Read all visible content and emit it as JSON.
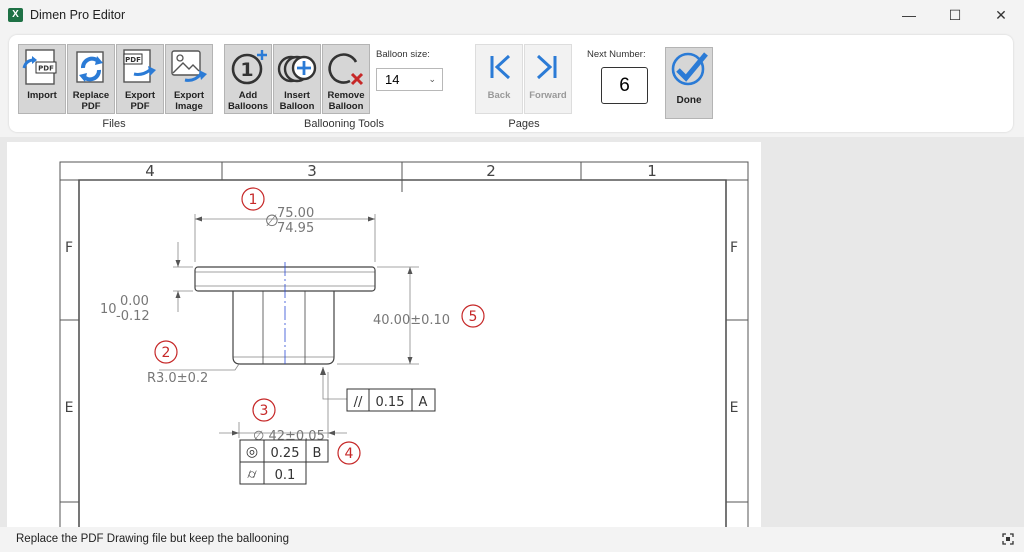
{
  "window": {
    "title": "Dimen Pro Editor",
    "app_icon_letter": "X",
    "controls": {
      "minimize": "—",
      "maximize": "☐",
      "close": "✕"
    }
  },
  "ribbon": {
    "files": {
      "label": "Files",
      "buttons": [
        {
          "label": "Import",
          "icon": "import-pdf-icon"
        },
        {
          "label": "Replace\nPDF",
          "icon": "replace-pdf-icon"
        },
        {
          "label": "Export\nPDF",
          "icon": "export-pdf-icon"
        },
        {
          "label": "Export\nImage",
          "icon": "export-image-icon"
        }
      ],
      "pdf_badge": "PDF"
    },
    "ballooning": {
      "label": "Ballooning Tools",
      "buttons": [
        {
          "label": "Add\nBalloons",
          "icon": "add-balloon-icon"
        },
        {
          "label": "Insert\nBalloon",
          "icon": "insert-balloon-icon"
        },
        {
          "label": "Remove\nBalloon",
          "icon": "remove-balloon-icon"
        }
      ],
      "add_badge": "1",
      "size_label": "Balloon size:",
      "size_value": "14"
    },
    "pages": {
      "label": "Pages",
      "buttons": [
        {
          "label": "Back",
          "icon": "back-icon",
          "enabled": false
        },
        {
          "label": "Forward",
          "icon": "forward-icon",
          "enabled": false
        }
      ]
    },
    "next_number_label": "Next Number:",
    "next_number": "6",
    "done_label": "Done",
    "accent": "#2b7bd6"
  },
  "drawing": {
    "columns": [
      "4",
      "3",
      "2",
      "1"
    ],
    "rows": [
      "F",
      "E"
    ],
    "balloon_color": "#c62828",
    "balloons": [
      {
        "number": "1"
      },
      {
        "number": "2"
      },
      {
        "number": "3"
      },
      {
        "number": "4"
      },
      {
        "number": "5"
      }
    ],
    "dim_diameter_upper": "75.00",
    "dim_diameter_lower": "74.95",
    "dim_diameter_symbol": "∅",
    "dim_flange_base": "10",
    "dim_flange_upper": "0.00",
    "dim_flange_lower": "-0.12",
    "dim_radius": "R3.0±0.2",
    "dim_height": "40.00±0.10",
    "dim_bore": "∅ 42±0.05",
    "fcf_parallel": {
      "symbol": "//",
      "tolerance": "0.15",
      "datum": "A"
    },
    "fcf_concentric": {
      "symbol": "◎",
      "tolerance": "0.25",
      "datum": "B"
    },
    "fcf_cylindricity": {
      "symbol": "⌭",
      "tolerance": "0.1"
    }
  },
  "status": {
    "text": "Replace the PDF Drawing file but keep the ballooning"
  }
}
